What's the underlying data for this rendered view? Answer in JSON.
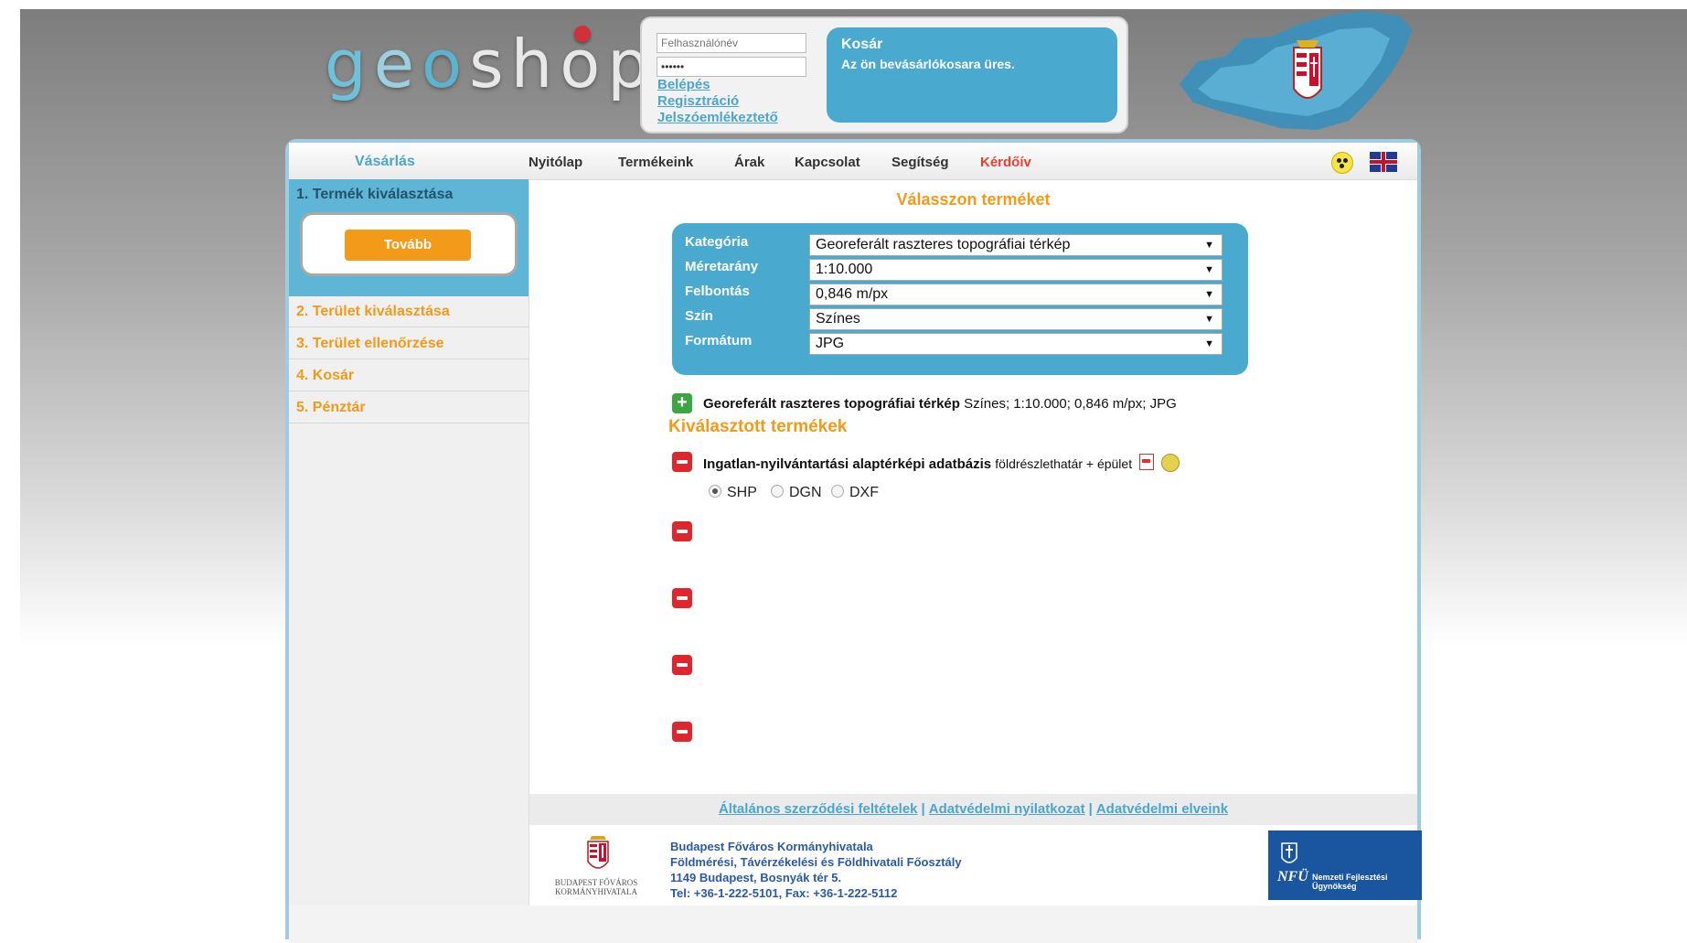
{
  "header": {
    "logo_text": "geoshop",
    "login": {
      "username_placeholder": "Felhasználónév",
      "password_value": "••••••",
      "links": [
        "Belépés",
        "Regisztráció",
        "Jelszóemlékeztető"
      ]
    },
    "cart": {
      "title": "Kosár",
      "text": "Az ön bevásárlókosara üres."
    }
  },
  "nav": {
    "section_label": "Vásárlás",
    "items": [
      "Nyitólap",
      "Termékeink",
      "Árak",
      "Kapcsolat",
      "Segítség",
      "Kérdőív"
    ],
    "accessibility_icon": "accessibility-icon",
    "language_icon": "uk-flag-icon"
  },
  "sidebar": {
    "active_step": "1. Termék kiválasztása",
    "next_button": "Tovább",
    "steps": [
      "2. Terület kiválasztása",
      "3. Terület ellenőrzése",
      "4. Kosár",
      "5. Pénztár"
    ]
  },
  "main": {
    "title": "Válasszon terméket",
    "selectors": [
      {
        "label": "Kategória",
        "value": "Georeferált raszteres topográfiai térkép"
      },
      {
        "label": "Méretarány",
        "value": "1:10.000"
      },
      {
        "label": "Felbontás",
        "value": "0,846 m/px"
      },
      {
        "label": "Szín",
        "value": "Színes"
      },
      {
        "label": "Formátum",
        "value": "JPG"
      }
    ],
    "candidate": {
      "name": "Georeferált raszteres topográfiai térkép",
      "details": "Színes; 1:10.000; 0,846 m/px; JPG"
    },
    "selected_title": "Kiválasztott termékek",
    "selected": {
      "name": "Ingatlan-nyilvántartási alaptérképi adatbázis",
      "details": "földrészlethatár + épület"
    },
    "formats": [
      "SHP",
      "DGN",
      "DXF"
    ],
    "selected_format": "SHP"
  },
  "footer": {
    "links": [
      "Általános szerződési feltételek",
      "Adatvédelmi nyilatkozat",
      "Adatvédelmi elveink"
    ],
    "separator": "|",
    "org_lines": [
      "Budapest Főváros Kormányhivatala",
      "Földmérési, Távérzékelési és Földhivatali Főosztály",
      "1149 Budapest, Bosnyák tér 5.",
      "Tel: +36-1-222-5101, Fax: +36-1-222-5112"
    ],
    "crest_caption": "BUDAPEST FŐVÁROS KORMÁNYHIVATALA",
    "nfu_mark": "NFÜ",
    "nfu_caption": "Nemzeti Fejlesztési Ügynökség"
  },
  "colors": {
    "accent_blue": "#4aa9cf",
    "accent_orange": "#f39a19",
    "remove_red": "#e0262d",
    "add_green": "#3ca544"
  }
}
